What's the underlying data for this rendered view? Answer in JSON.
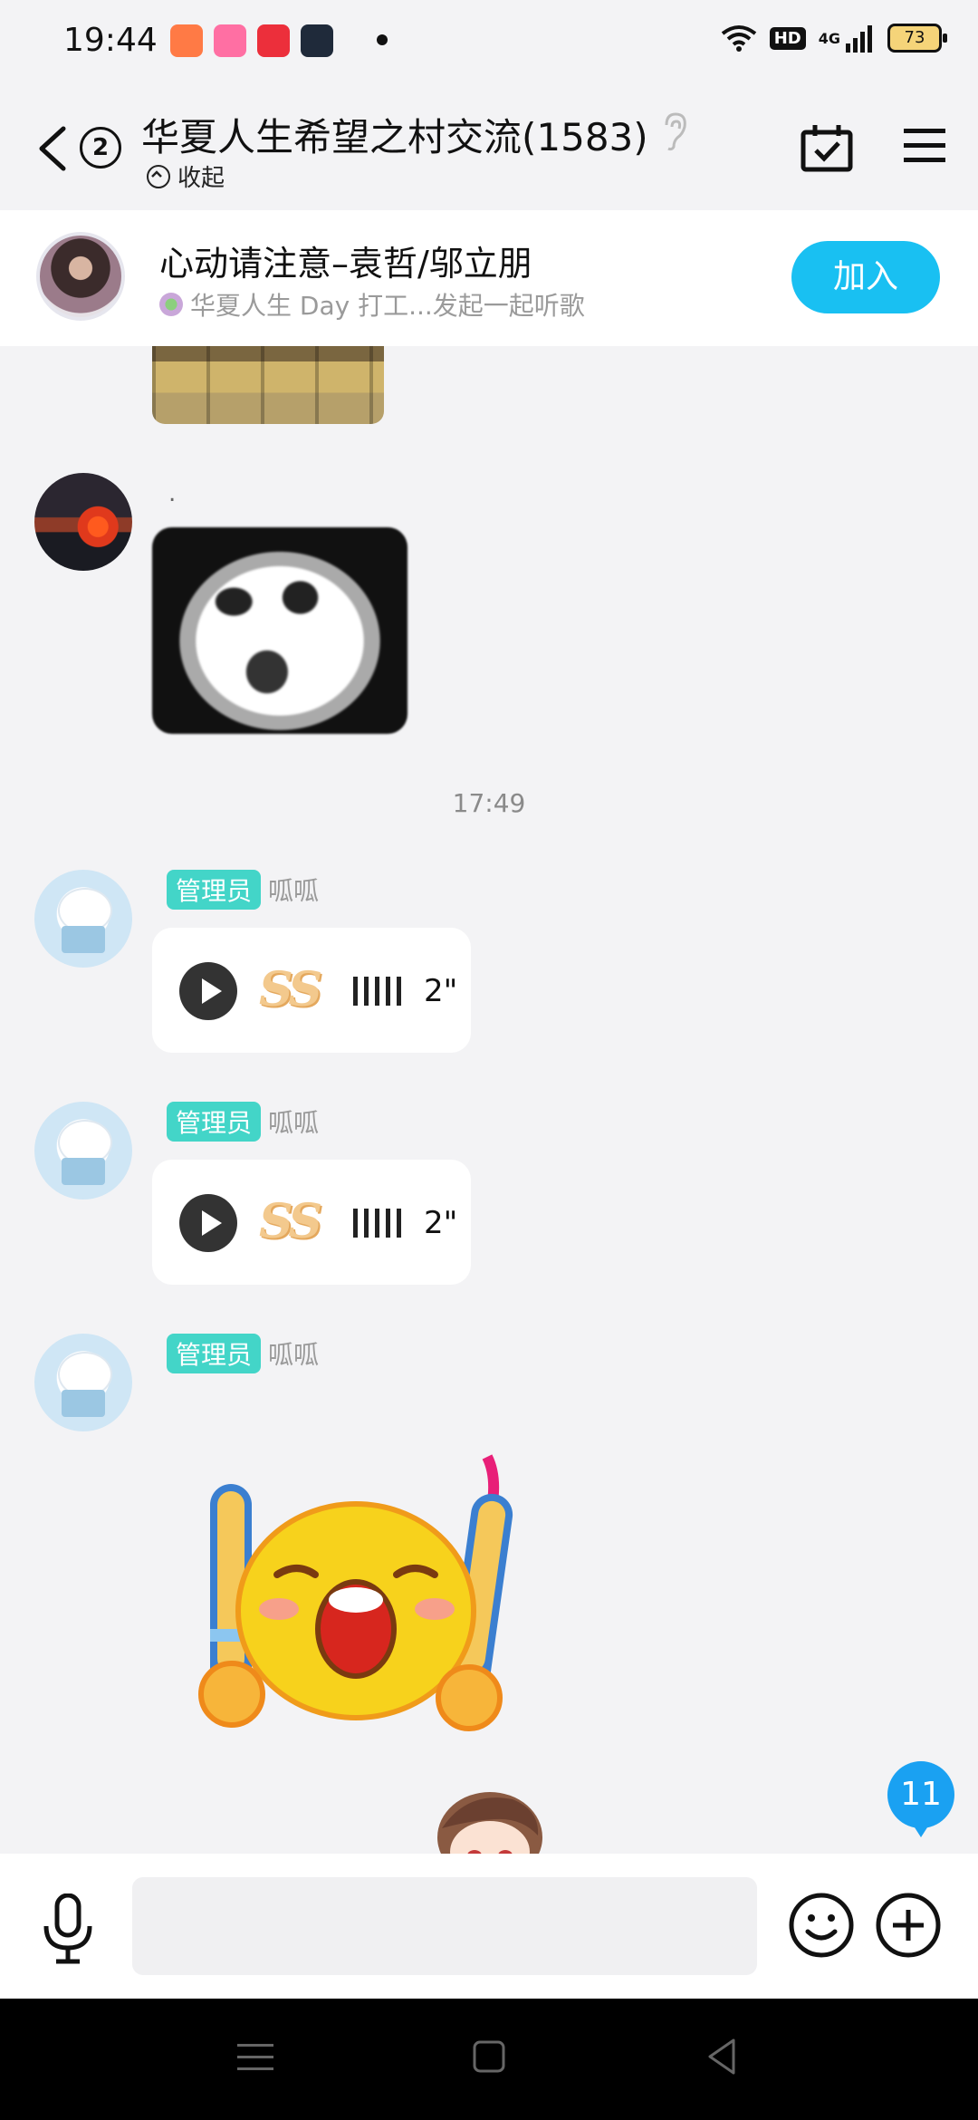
{
  "status_bar": {
    "time": "19:44",
    "hd_label": "HD",
    "network_label": "4G",
    "battery": "73",
    "app_icons": [
      "music-app-icon",
      "bilibili-app-icon",
      "taote-app-icon",
      "game-app-icon"
    ]
  },
  "header": {
    "back_count": "2",
    "title": "华夏人生希望之村交流(1583)",
    "collapse_label": "收起"
  },
  "live_banner": {
    "title": "心动请注意–袁哲/邬立朋",
    "subtitle": "华夏人生 Day 打工...发起一起听歌",
    "join_label": "加入"
  },
  "messages": {
    "msg1_sender": ".",
    "timestamp": "17:49",
    "voice1": {
      "role_tag": "管理员",
      "sender": "呱呱",
      "duration": "2\""
    },
    "voice2": {
      "role_tag": "管理员",
      "sender": "呱呱",
      "duration": "2\""
    },
    "sticker_msg": {
      "role_tag": "管理员",
      "sender": "呱呱"
    }
  },
  "ss_text": "SS",
  "unread_badge": "11",
  "input": {
    "placeholder": ""
  },
  "colors": {
    "accent": "#19c0f2",
    "admin_tag": "#43d5c8",
    "badge": "#1aa1f2",
    "background": "#f3f3f5"
  }
}
